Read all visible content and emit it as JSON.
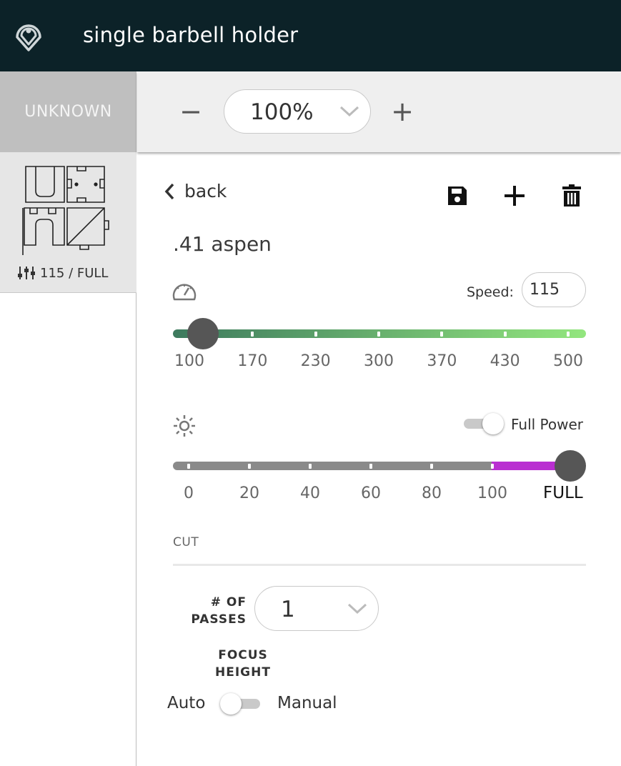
{
  "app": {
    "title": "single barbell holder",
    "logo": "location-pin-logo"
  },
  "sidebar": {
    "tab_label": "UNKNOWN",
    "material_card": {
      "setting_icon": "sliders-icon",
      "setting_text": "115 / FULL"
    }
  },
  "toolbar": {
    "zoom_minus": "−",
    "zoom_value": "100%",
    "zoom_plus": "+"
  },
  "panel": {
    "back_label": "back",
    "actions": [
      "save-icon",
      "add-icon",
      "trash-icon"
    ],
    "material_name": ".41 aspen",
    "speed": {
      "icon": "speedometer-icon",
      "label": "Speed:",
      "value": "115",
      "ticks": [
        "100",
        "170",
        "230",
        "300",
        "370",
        "430",
        "500"
      ],
      "track_colors": [
        "#3d7a5e",
        "#93e67e"
      ]
    },
    "power": {
      "icon": "sun-icon",
      "toggle_label": "Full Power",
      "ticks": [
        "0",
        "20",
        "40",
        "60",
        "80",
        "100"
      ],
      "max_label": "FULL",
      "track_color": "#8a8a8a",
      "full_color": "#b92fd1"
    },
    "section_label": "CUT",
    "passes": {
      "label_line1": "# OF",
      "label_line2": "PASSES",
      "value": "1"
    },
    "focus": {
      "label_line1": "FOCUS",
      "label_line2": "HEIGHT",
      "auto_label": "Auto",
      "manual_label": "Manual"
    }
  }
}
